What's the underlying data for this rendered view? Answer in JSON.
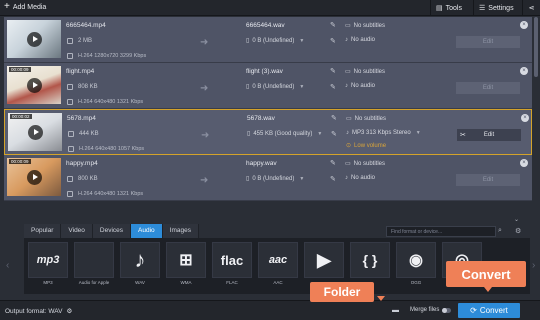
{
  "toolbar": {
    "add_media": "Add Media",
    "tools": "Tools",
    "settings": "Settings"
  },
  "files": [
    {
      "time": "",
      "src_name": "6665464.mp4",
      "src_size": "2 MB",
      "src_info": "H.264 1280x720 3299 Kbps",
      "out_name": "6665464.wav",
      "out_size": "0 B (Undefined)",
      "subtitles": "No subtitles",
      "audio": "No audio",
      "edit": "Edit",
      "selected": false
    },
    {
      "time": "00:00:09",
      "src_name": "flight.mp4",
      "src_size": "808 KB",
      "src_info": "H.264 640x480 1321 Kbps",
      "out_name": "flight (3).wav",
      "out_size": "0 B (Undefined)",
      "subtitles": "No subtitles",
      "audio": "No audio",
      "edit": "Edit",
      "selected": false
    },
    {
      "time": "00:00:02",
      "src_name": "5678.mp4",
      "src_size": "444 KB",
      "src_info": "H.264 640x480 1057 Kbps",
      "out_name": "5678.wav",
      "out_size": "455 KB (Good quality)",
      "subtitles": "No subtitles",
      "audio": "MP3 313 Kbps Stereo",
      "warning": "Low volume",
      "edit": "Edit",
      "selected": true
    },
    {
      "time": "00:00:09",
      "src_name": "happy.mp4",
      "src_size": "800 KB",
      "src_info": "H.264 640x480 1321 Kbps",
      "out_name": "happy.wav",
      "out_size": "0 B (Undefined)",
      "subtitles": "No subtitles",
      "audio": "No audio",
      "edit": "Edit",
      "selected": false
    }
  ],
  "tabs": [
    "Popular",
    "Video",
    "Devices",
    "Audio",
    "Images"
  ],
  "active_tab": "Audio",
  "search": {
    "placeholder": "Find format or device..."
  },
  "formats": [
    {
      "icon": "mp3",
      "label": "MP3"
    },
    {
      "icon": "apple-logo-icon",
      "label": "Audio for Apple"
    },
    {
      "icon": "music-note-icon",
      "label": "WAV"
    },
    {
      "icon": "windows-logo-icon",
      "label": "WMA"
    },
    {
      "icon": "flac",
      "label": "FLAC"
    },
    {
      "icon": "aac",
      "label": "AAC"
    },
    {
      "icon": "play-circle-icon",
      "label": ""
    },
    {
      "icon": "curly-braces-icon",
      "label": ""
    },
    {
      "icon": "ogg",
      "label": "OGG"
    },
    {
      "icon": "disc-icon",
      "label": ""
    }
  ],
  "bottom": {
    "output_format": "Output format: WAV",
    "merge": "Merge files",
    "convert": "Convert"
  },
  "callouts": {
    "folder": "Folder",
    "convert": "Convert"
  },
  "colors": {
    "accent": "#2d8cd9",
    "callout": "#ef8057",
    "warning": "#d9a53a",
    "selected_border": "#d4a32a"
  }
}
